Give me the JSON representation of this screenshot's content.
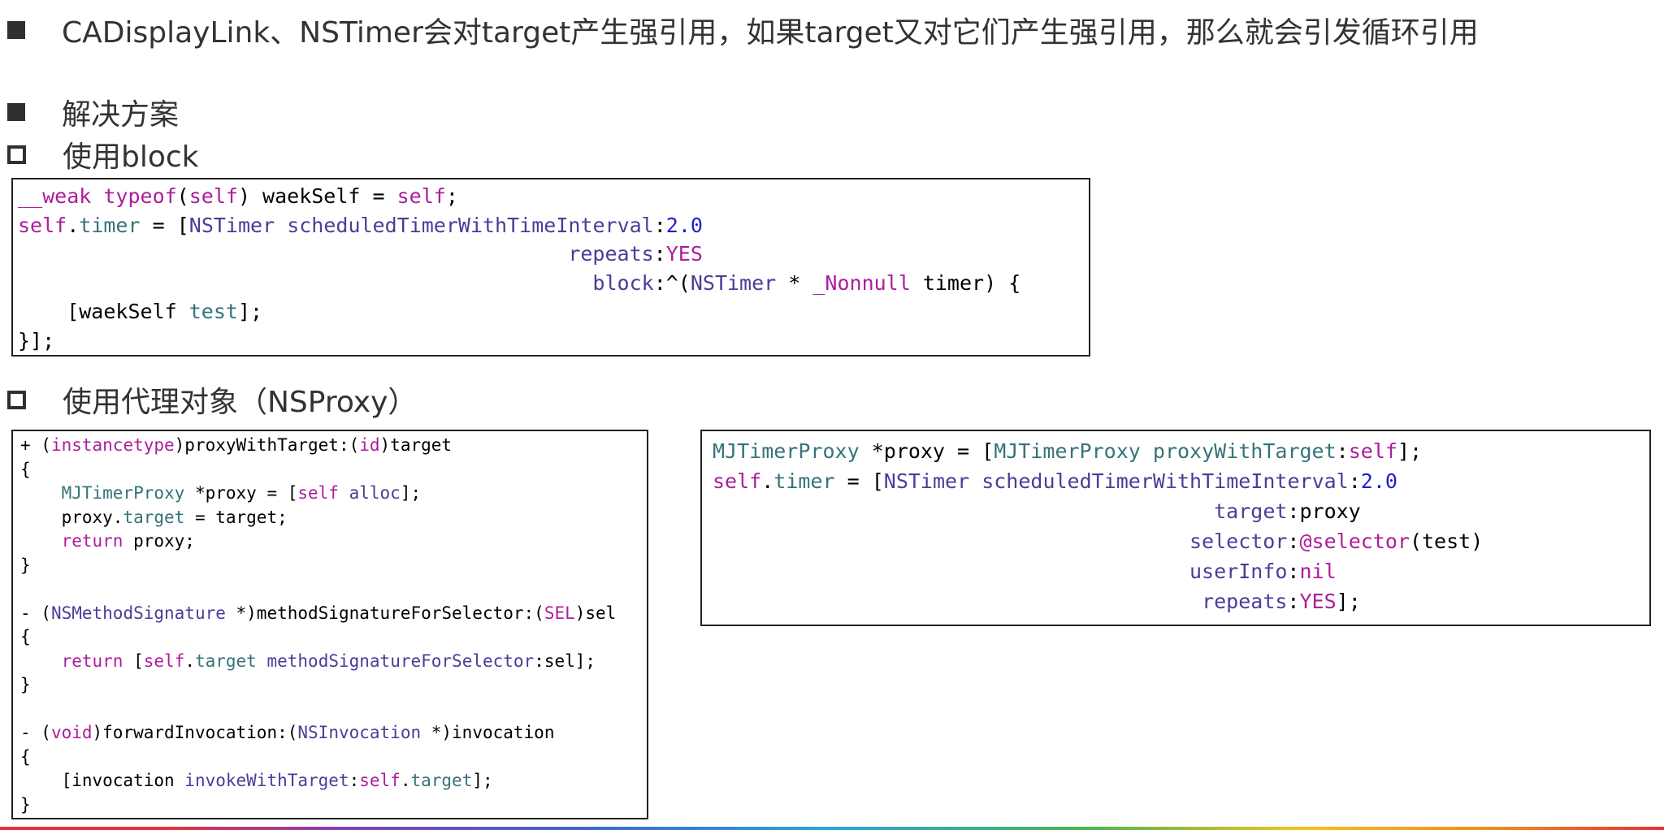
{
  "headings": {
    "problem": "CADisplayLink、NSTimer会对target产生强引用，如果target又对它们产生强引用，那么就会引发循环引用",
    "solution": "解决方案",
    "use_block": "使用block",
    "use_proxy": "使用代理对象（NSProxy）"
  },
  "icons": {
    "filled_bullet": "filled-square-icon",
    "hollow_bullet": "hollow-square-icon"
  },
  "code_block": [
    [
      {
        "t": "__weak ",
        "c": "kw"
      },
      {
        "t": "typeof",
        "c": "kw"
      },
      {
        "t": "("
      },
      {
        "t": "self",
        "c": "kw"
      },
      {
        "t": ") waekSelf = "
      },
      {
        "t": "self",
        "c": "kw"
      },
      {
        "t": ";"
      }
    ],
    [
      {
        "t": "self",
        "c": "kw"
      },
      {
        "t": "."
      },
      {
        "t": "timer",
        "c": "pr"
      },
      {
        "t": " = ["
      },
      {
        "t": "NSTimer",
        "c": "ty"
      },
      {
        "t": " "
      },
      {
        "t": "scheduledTimerWithTimeInterval",
        "c": "ty"
      },
      {
        "t": ":"
      },
      {
        "t": "2.0",
        "c": "nm"
      }
    ],
    [
      {
        "t": "                                             "
      },
      {
        "t": "repeats",
        "c": "ty"
      },
      {
        "t": ":"
      },
      {
        "t": "YES",
        "c": "kw"
      }
    ],
    [
      {
        "t": "                                               "
      },
      {
        "t": "block",
        "c": "ty"
      },
      {
        "t": ":^("
      },
      {
        "t": "NSTimer",
        "c": "ty"
      },
      {
        "t": " * "
      },
      {
        "t": "_Nonnull",
        "c": "kw"
      },
      {
        "t": " timer) {"
      }
    ],
    [
      {
        "t": "    [waekSelf "
      },
      {
        "t": "test",
        "c": "pr"
      },
      {
        "t": "];"
      }
    ],
    [
      {
        "t": "}];"
      }
    ]
  ],
  "code_proxy_impl": [
    [
      {
        "t": "+ ("
      },
      {
        "t": "instancetype",
        "c": "kw"
      },
      {
        "t": ")proxyWithTarget:("
      },
      {
        "t": "id",
        "c": "kw"
      },
      {
        "t": ")target"
      }
    ],
    [
      {
        "t": "{"
      }
    ],
    [
      {
        "t": "    "
      },
      {
        "t": "MJTimerProxy",
        "c": "pr"
      },
      {
        "t": " *proxy = ["
      },
      {
        "t": "self",
        "c": "kw"
      },
      {
        "t": " "
      },
      {
        "t": "alloc",
        "c": "ty"
      },
      {
        "t": "];"
      }
    ],
    [
      {
        "t": "    proxy."
      },
      {
        "t": "target",
        "c": "pr"
      },
      {
        "t": " = target;"
      }
    ],
    [
      {
        "t": "    "
      },
      {
        "t": "return",
        "c": "kw"
      },
      {
        "t": " proxy;"
      }
    ],
    [
      {
        "t": "}"
      }
    ],
    [
      {
        "t": ""
      }
    ],
    [
      {
        "t": "- ("
      },
      {
        "t": "NSMethodSignature",
        "c": "ty"
      },
      {
        "t": " *)methodSignatureForSelector:("
      },
      {
        "t": "SEL",
        "c": "kw"
      },
      {
        "t": ")sel"
      }
    ],
    [
      {
        "t": "{"
      }
    ],
    [
      {
        "t": "    "
      },
      {
        "t": "return",
        "c": "kw"
      },
      {
        "t": " ["
      },
      {
        "t": "self",
        "c": "kw"
      },
      {
        "t": "."
      },
      {
        "t": "target",
        "c": "pr"
      },
      {
        "t": " "
      },
      {
        "t": "methodSignatureForSelector",
        "c": "ty"
      },
      {
        "t": ":sel];"
      }
    ],
    [
      {
        "t": "}"
      }
    ],
    [
      {
        "t": ""
      }
    ],
    [
      {
        "t": "- ("
      },
      {
        "t": "void",
        "c": "kw"
      },
      {
        "t": ")forwardInvocation:("
      },
      {
        "t": "NSInvocation",
        "c": "ty"
      },
      {
        "t": " *)invocation"
      }
    ],
    [
      {
        "t": "{"
      }
    ],
    [
      {
        "t": "    [invocation "
      },
      {
        "t": "invokeWithTarget",
        "c": "ty"
      },
      {
        "t": ":"
      },
      {
        "t": "self",
        "c": "kw"
      },
      {
        "t": "."
      },
      {
        "t": "target",
        "c": "pr"
      },
      {
        "t": "];"
      }
    ],
    [
      {
        "t": "}"
      }
    ]
  ],
  "code_proxy_usage": [
    [
      {
        "t": "MJTimerProxy",
        "c": "pr"
      },
      {
        "t": " *proxy = ["
      },
      {
        "t": "MJTimerProxy",
        "c": "pr"
      },
      {
        "t": " "
      },
      {
        "t": "proxyWithTarget",
        "c": "pr"
      },
      {
        "t": ":"
      },
      {
        "t": "self",
        "c": "kw"
      },
      {
        "t": "];"
      }
    ],
    [
      {
        "t": "self",
        "c": "kw"
      },
      {
        "t": "."
      },
      {
        "t": "timer",
        "c": "pr"
      },
      {
        "t": " = ["
      },
      {
        "t": "NSTimer",
        "c": "ty"
      },
      {
        "t": " "
      },
      {
        "t": "scheduledTimerWithTimeInterval",
        "c": "ty"
      },
      {
        "t": ":"
      },
      {
        "t": "2.0",
        "c": "nm"
      }
    ],
    [
      {
        "t": "                                         "
      },
      {
        "t": "target",
        "c": "ty"
      },
      {
        "t": ":proxy"
      }
    ],
    [
      {
        "t": "                                       "
      },
      {
        "t": "selector",
        "c": "ty"
      },
      {
        "t": ":"
      },
      {
        "t": "@selector",
        "c": "kw"
      },
      {
        "t": "(test)"
      }
    ],
    [
      {
        "t": "                                       "
      },
      {
        "t": "userInfo",
        "c": "ty"
      },
      {
        "t": ":"
      },
      {
        "t": "nil",
        "c": "kw"
      }
    ],
    [
      {
        "t": "                                        "
      },
      {
        "t": "repeats",
        "c": "ty"
      },
      {
        "t": ":"
      },
      {
        "t": "YES",
        "c": "kw"
      },
      {
        "t": "];"
      }
    ]
  ],
  "colors": {
    "keyword": "#ad1d9b",
    "type_method": "#4f3a9a",
    "property": "#35737a",
    "number": "#1d1fd0"
  }
}
